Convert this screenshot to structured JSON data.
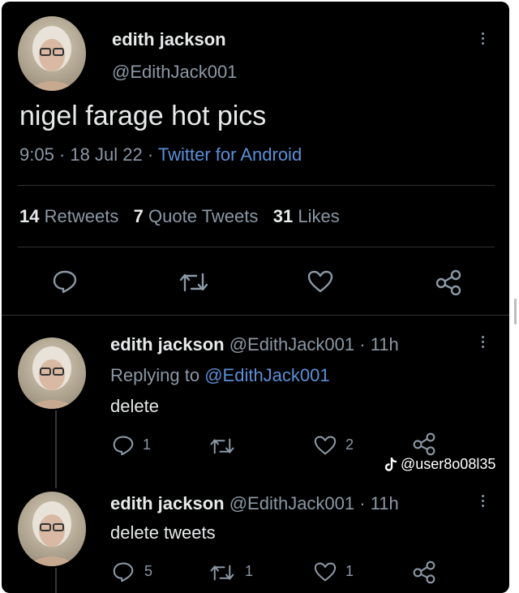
{
  "main_tweet": {
    "name": "edith jackson",
    "handle": "@EdithJack001",
    "text": "nigel farage hot pics",
    "time": "9:05",
    "date": "18 Jul 22",
    "source": "Twitter for Android",
    "sep": "·",
    "stats": {
      "retweets_count": "14",
      "retweets_label": "Retweets",
      "quotes_count": "7",
      "quotes_label": "Quote Tweets",
      "likes_count": "31",
      "likes_label": "Likes"
    }
  },
  "reply1": {
    "name": "edith jackson",
    "handle": "@EdithJack001",
    "age": "· 11h",
    "replying_label": "Replying to",
    "replying_to": "@EdithJack001",
    "text": "delete",
    "reply_count": "1",
    "like_count": "2"
  },
  "reply2": {
    "name": "edith jackson",
    "handle": "@EdithJack001",
    "age": "· 11h",
    "text": "delete tweets",
    "reply_count": "5",
    "retweet_count": "1",
    "like_count": "1"
  },
  "watermark": {
    "text": "@user8o08l35"
  },
  "icons": [
    "reply-icon",
    "retweet-icon",
    "like-icon",
    "share-icon",
    "more-icon",
    "tiktok-icon"
  ]
}
